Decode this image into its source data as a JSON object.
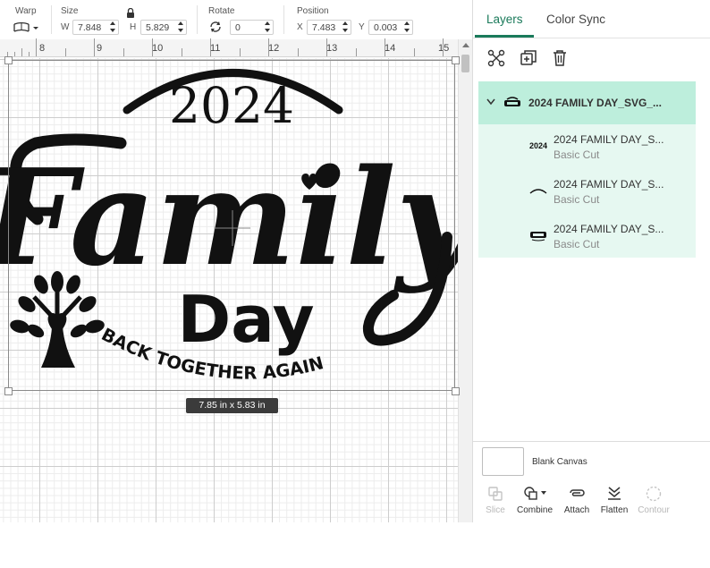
{
  "toolbar": {
    "warp": {
      "title": "Warp"
    },
    "size": {
      "title": "Size",
      "w_label": "W",
      "w_value": "7.848",
      "h_label": "H",
      "h_value": "5.829"
    },
    "rotate": {
      "title": "Rotate",
      "value": "0"
    },
    "position": {
      "title": "Position",
      "x_label": "X",
      "x_value": "7.483",
      "y_label": "Y",
      "y_value": "0.003"
    }
  },
  "ruler": {
    "marks": [
      "8",
      "9",
      "10",
      "11",
      "12",
      "13",
      "14",
      "15"
    ]
  },
  "canvas": {
    "design": {
      "year": "2024",
      "word1": "Family",
      "word2": "Day",
      "arc_text": "BACK TOGETHER AGAIN"
    },
    "size_tooltip": "7.85  in x 5.83  in"
  },
  "panel": {
    "tabs": [
      {
        "label": "Layers",
        "active": true
      },
      {
        "label": "Color Sync",
        "active": false
      }
    ],
    "group": {
      "title": "2024 FAMILY DAY_SVG_..."
    },
    "layers": [
      {
        "thumb": "2024",
        "title": "2024 FAMILY DAY_S...",
        "subtitle": "Basic Cut"
      },
      {
        "thumb": "arc",
        "title": "2024 FAMILY DAY_S...",
        "subtitle": "Basic Cut"
      },
      {
        "thumb": "family",
        "title": "2024 FAMILY DAY_S...",
        "subtitle": "Basic Cut"
      }
    ],
    "blank_canvas": "Blank Canvas",
    "actions": [
      {
        "label": "Slice",
        "enabled": false
      },
      {
        "label": "Combine",
        "enabled": true
      },
      {
        "label": "Attach",
        "enabled": true
      },
      {
        "label": "Flatten",
        "enabled": true
      },
      {
        "label": "Contour",
        "enabled": false
      }
    ]
  },
  "colors": {
    "accent": "#1a7a5a",
    "layer_selected": "#bdeedc",
    "layer_group_bg": "#e6f8f1"
  }
}
